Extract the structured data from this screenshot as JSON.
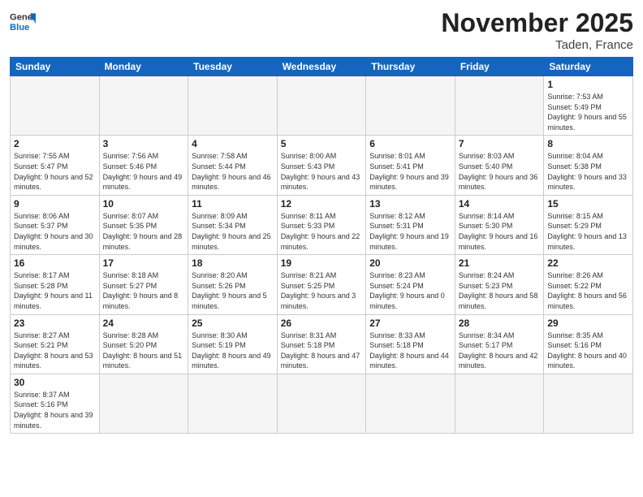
{
  "logo": {
    "text_general": "General",
    "text_blue": "Blue"
  },
  "title": "November 2025",
  "subtitle": "Taden, France",
  "weekdays": [
    "Sunday",
    "Monday",
    "Tuesday",
    "Wednesday",
    "Thursday",
    "Friday",
    "Saturday"
  ],
  "weeks": [
    [
      {
        "day": "",
        "info": ""
      },
      {
        "day": "",
        "info": ""
      },
      {
        "day": "",
        "info": ""
      },
      {
        "day": "",
        "info": ""
      },
      {
        "day": "",
        "info": ""
      },
      {
        "day": "",
        "info": ""
      },
      {
        "day": "1",
        "info": "Sunrise: 7:53 AM\nSunset: 5:49 PM\nDaylight: 9 hours and 55 minutes."
      }
    ],
    [
      {
        "day": "2",
        "info": "Sunrise: 7:55 AM\nSunset: 5:47 PM\nDaylight: 9 hours and 52 minutes."
      },
      {
        "day": "3",
        "info": "Sunrise: 7:56 AM\nSunset: 5:46 PM\nDaylight: 9 hours and 49 minutes."
      },
      {
        "day": "4",
        "info": "Sunrise: 7:58 AM\nSunset: 5:44 PM\nDaylight: 9 hours and 46 minutes."
      },
      {
        "day": "5",
        "info": "Sunrise: 8:00 AM\nSunset: 5:43 PM\nDaylight: 9 hours and 43 minutes."
      },
      {
        "day": "6",
        "info": "Sunrise: 8:01 AM\nSunset: 5:41 PM\nDaylight: 9 hours and 39 minutes."
      },
      {
        "day": "7",
        "info": "Sunrise: 8:03 AM\nSunset: 5:40 PM\nDaylight: 9 hours and 36 minutes."
      },
      {
        "day": "8",
        "info": "Sunrise: 8:04 AM\nSunset: 5:38 PM\nDaylight: 9 hours and 33 minutes."
      }
    ],
    [
      {
        "day": "9",
        "info": "Sunrise: 8:06 AM\nSunset: 5:37 PM\nDaylight: 9 hours and 30 minutes."
      },
      {
        "day": "10",
        "info": "Sunrise: 8:07 AM\nSunset: 5:35 PM\nDaylight: 9 hours and 28 minutes."
      },
      {
        "day": "11",
        "info": "Sunrise: 8:09 AM\nSunset: 5:34 PM\nDaylight: 9 hours and 25 minutes."
      },
      {
        "day": "12",
        "info": "Sunrise: 8:11 AM\nSunset: 5:33 PM\nDaylight: 9 hours and 22 minutes."
      },
      {
        "day": "13",
        "info": "Sunrise: 8:12 AM\nSunset: 5:31 PM\nDaylight: 9 hours and 19 minutes."
      },
      {
        "day": "14",
        "info": "Sunrise: 8:14 AM\nSunset: 5:30 PM\nDaylight: 9 hours and 16 minutes."
      },
      {
        "day": "15",
        "info": "Sunrise: 8:15 AM\nSunset: 5:29 PM\nDaylight: 9 hours and 13 minutes."
      }
    ],
    [
      {
        "day": "16",
        "info": "Sunrise: 8:17 AM\nSunset: 5:28 PM\nDaylight: 9 hours and 11 minutes."
      },
      {
        "day": "17",
        "info": "Sunrise: 8:18 AM\nSunset: 5:27 PM\nDaylight: 9 hours and 8 minutes."
      },
      {
        "day": "18",
        "info": "Sunrise: 8:20 AM\nSunset: 5:26 PM\nDaylight: 9 hours and 5 minutes."
      },
      {
        "day": "19",
        "info": "Sunrise: 8:21 AM\nSunset: 5:25 PM\nDaylight: 9 hours and 3 minutes."
      },
      {
        "day": "20",
        "info": "Sunrise: 8:23 AM\nSunset: 5:24 PM\nDaylight: 9 hours and 0 minutes."
      },
      {
        "day": "21",
        "info": "Sunrise: 8:24 AM\nSunset: 5:23 PM\nDaylight: 8 hours and 58 minutes."
      },
      {
        "day": "22",
        "info": "Sunrise: 8:26 AM\nSunset: 5:22 PM\nDaylight: 8 hours and 56 minutes."
      }
    ],
    [
      {
        "day": "23",
        "info": "Sunrise: 8:27 AM\nSunset: 5:21 PM\nDaylight: 8 hours and 53 minutes."
      },
      {
        "day": "24",
        "info": "Sunrise: 8:28 AM\nSunset: 5:20 PM\nDaylight: 8 hours and 51 minutes."
      },
      {
        "day": "25",
        "info": "Sunrise: 8:30 AM\nSunset: 5:19 PM\nDaylight: 8 hours and 49 minutes."
      },
      {
        "day": "26",
        "info": "Sunrise: 8:31 AM\nSunset: 5:18 PM\nDaylight: 8 hours and 47 minutes."
      },
      {
        "day": "27",
        "info": "Sunrise: 8:33 AM\nSunset: 5:18 PM\nDaylight: 8 hours and 44 minutes."
      },
      {
        "day": "28",
        "info": "Sunrise: 8:34 AM\nSunset: 5:17 PM\nDaylight: 8 hours and 42 minutes."
      },
      {
        "day": "29",
        "info": "Sunrise: 8:35 AM\nSunset: 5:16 PM\nDaylight: 8 hours and 40 minutes."
      }
    ],
    [
      {
        "day": "30",
        "info": "Sunrise: 8:37 AM\nSunset: 5:16 PM\nDaylight: 8 hours and 39 minutes."
      },
      {
        "day": "",
        "info": ""
      },
      {
        "day": "",
        "info": ""
      },
      {
        "day": "",
        "info": ""
      },
      {
        "day": "",
        "info": ""
      },
      {
        "day": "",
        "info": ""
      },
      {
        "day": "",
        "info": ""
      }
    ]
  ]
}
